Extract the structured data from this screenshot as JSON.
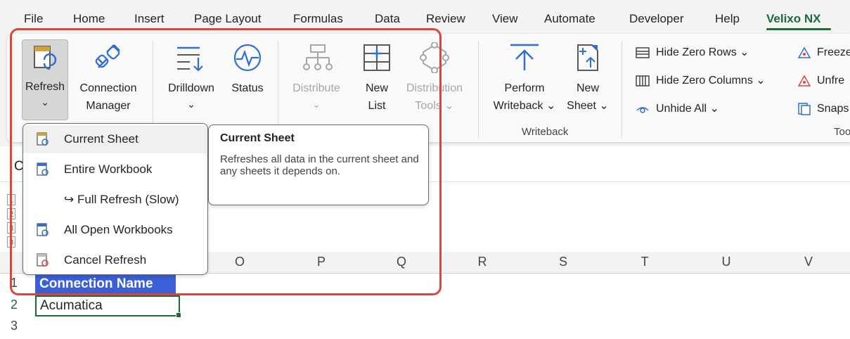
{
  "menu": {
    "tabs": [
      "File",
      "Home",
      "Insert",
      "Page Layout",
      "Formulas",
      "Data",
      "Review",
      "View",
      "Automate",
      "Developer",
      "Help",
      "Velixo NX"
    ],
    "active_tab": "Velixo NX"
  },
  "ribbon": {
    "refresh": {
      "label": "Refresh",
      "arrow": "⌄"
    },
    "connection_manager": {
      "line1": "Connection",
      "line2": "Manager"
    },
    "drilldown": {
      "label": "Drilldown",
      "arrow": "⌄"
    },
    "status": {
      "label": "Status"
    },
    "distribute": {
      "label": "Distribute",
      "arrow": "⌄"
    },
    "new_list": {
      "line1": "New",
      "line2": "List"
    },
    "distribution_tools": {
      "line1": "Distribution",
      "line2": "Tools ⌄"
    },
    "perform_writeback": {
      "line1": "Perform",
      "line2": "Writeback ⌄"
    },
    "new_sheet": {
      "line1": "New",
      "line2": "Sheet ⌄"
    },
    "writeback_group_label": "Writeback",
    "hide_zero_rows": "Hide Zero Rows ⌄",
    "hide_zero_columns": "Hide Zero Columns ⌄",
    "unhide_all": "Unhide All ⌄",
    "freeze": "Freeze",
    "unfreeze": "Unfre",
    "snapshot": "Snaps",
    "tools_group_label": "Too"
  },
  "dropdown": {
    "items": [
      {
        "label": "Current Sheet",
        "icon": "refresh-sheet-icon"
      },
      {
        "label": "Entire Workbook",
        "icon": "refresh-workbook-icon"
      },
      {
        "label": "↪ Full Refresh (Slow)",
        "icon": ""
      },
      {
        "label": "All Open Workbooks",
        "icon": "refresh-all-workbooks-icon"
      },
      {
        "label": "Cancel Refresh",
        "icon": "cancel-refresh-icon"
      }
    ]
  },
  "tooltip": {
    "title": "Current Sheet",
    "body": "Refreshes all data in the current sheet and any sheets it depends on."
  },
  "formula_bar": {
    "name_box_partial": "C"
  },
  "outline_levels": [
    "1",
    "2",
    "3"
  ],
  "columns": [
    "O",
    "P",
    "Q",
    "R",
    "S",
    "T",
    "U",
    "V"
  ],
  "rows": [
    "1",
    "2",
    "3"
  ],
  "cells": {
    "a1": "Connection Name",
    "a2": "Acumatica"
  },
  "colors": {
    "accent": "#1b6a3a",
    "highlight": "#d9473a",
    "selected_cell": "#3b5fd7"
  }
}
